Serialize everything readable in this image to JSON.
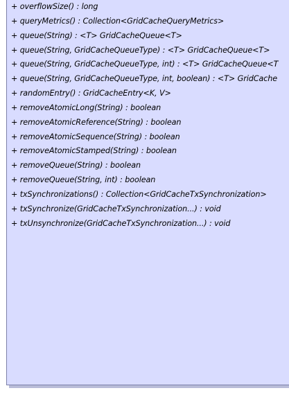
{
  "class_box": {
    "methods": [
      "+ overflowSize() : long",
      "+ queryMetrics() : Collection<GridCacheQueryMetrics>",
      "+ queue(String) : <T> GridCacheQueue<T>",
      "+ queue(String, GridCacheQueueType) : <T> GridCacheQueue<T>",
      "+ queue(String, GridCacheQueueType, int) : <T> GridCacheQueue<T",
      "+ queue(String, GridCacheQueueType, int, boolean) : <T> GridCache",
      "+ randomEntry() : GridCacheEntry<K, V>",
      "+ removeAtomicLong(String) : boolean",
      "+ removeAtomicReference(String) : boolean",
      "+ removeAtomicSequence(String) : boolean",
      "+ removeAtomicStamped(String) : boolean",
      "+ removeQueue(String) : boolean",
      "+ removeQueue(String, int) : boolean",
      "+ txSynchronizations() : Collection<GridCacheTxSynchronization>",
      "+ txSynchronize(GridCacheTxSynchronization...) : void",
      "+ txUnsynchronize(GridCacheTxSynchronization...) : void"
    ]
  },
  "colors": {
    "box_fill": "#d9dcff",
    "box_border": "#7c80a8",
    "shadow": "#b9bcd8",
    "text": "#000000"
  }
}
